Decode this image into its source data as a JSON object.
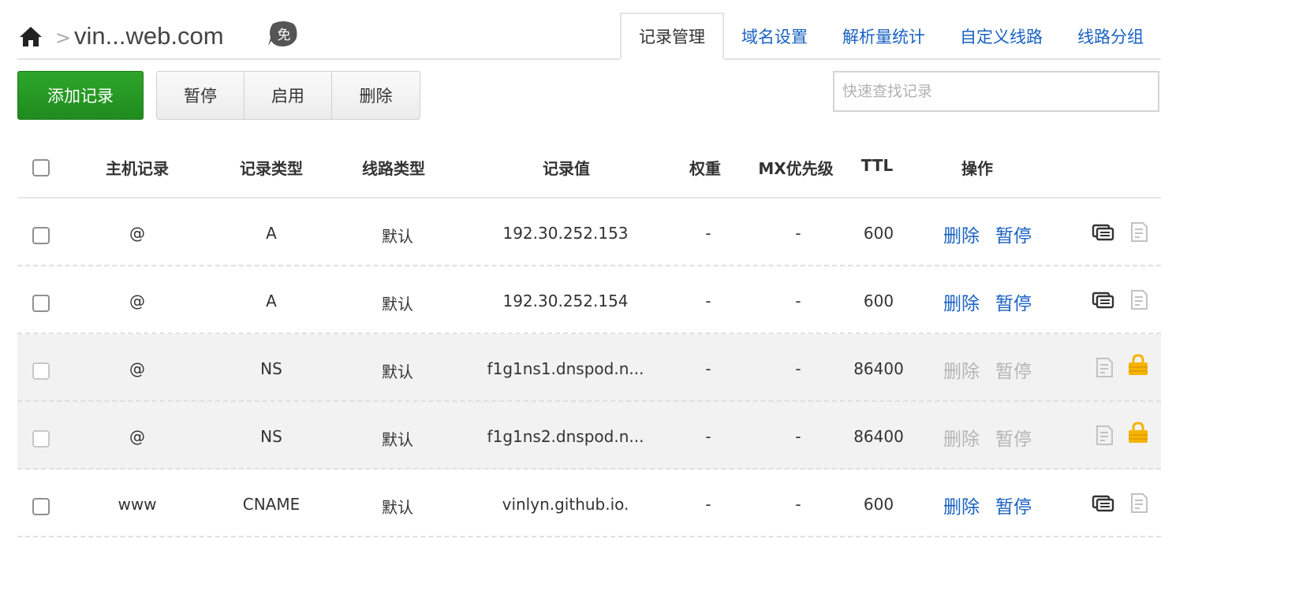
{
  "breadcrumb": {
    "separator": ">",
    "domain": "vin...web.com",
    "badge": "免"
  },
  "tabs": [
    {
      "label": "记录管理",
      "active": true
    },
    {
      "label": "域名设置",
      "active": false
    },
    {
      "label": "解析量统计",
      "active": false
    },
    {
      "label": "自定义线路",
      "active": false
    },
    {
      "label": "线路分组",
      "active": false
    }
  ],
  "toolbar": {
    "add_label": "添加记录",
    "pause_label": "暂停",
    "enable_label": "启用",
    "delete_label": "删除",
    "search_placeholder": "快速查找记录"
  },
  "table": {
    "headers": {
      "host": "主机记录",
      "type": "记录类型",
      "line": "线路类型",
      "value": "记录值",
      "weight": "权重",
      "mx": "MX优先级",
      "ttl": "TTL",
      "ops": "操作"
    },
    "rows": [
      {
        "host": "@",
        "type": "A",
        "line": "默认",
        "value": "192.30.252.153",
        "weight": "-",
        "mx": "-",
        "ttl": "600",
        "delete": "删除",
        "pause": "暂停",
        "locked": false
      },
      {
        "host": "@",
        "type": "A",
        "line": "默认",
        "value": "192.30.252.154",
        "weight": "-",
        "mx": "-",
        "ttl": "600",
        "delete": "删除",
        "pause": "暂停",
        "locked": false
      },
      {
        "host": "@",
        "type": "NS",
        "line": "默认",
        "value": "f1g1ns1.dnspod.n...",
        "weight": "-",
        "mx": "-",
        "ttl": "86400",
        "delete": "删除",
        "pause": "暂停",
        "locked": true
      },
      {
        "host": "@",
        "type": "NS",
        "line": "默认",
        "value": "f1g1ns2.dnspod.n...",
        "weight": "-",
        "mx": "-",
        "ttl": "86400",
        "delete": "删除",
        "pause": "暂停",
        "locked": true
      },
      {
        "host": "www",
        "type": "CNAME",
        "line": "默认",
        "value": "vinlyn.github.io.",
        "weight": "-",
        "mx": "-",
        "ttl": "600",
        "delete": "删除",
        "pause": "暂停",
        "locked": false
      }
    ]
  },
  "colors": {
    "accent_blue": "#1a62c2",
    "add_green": "#1f8c1e",
    "lock_yellow": "#f5b400",
    "disabled_gray": "#b5b5b5"
  },
  "icons": [
    "home-icon",
    "free-badge-icon",
    "remark-icon",
    "note-icon",
    "lock-icon"
  ]
}
